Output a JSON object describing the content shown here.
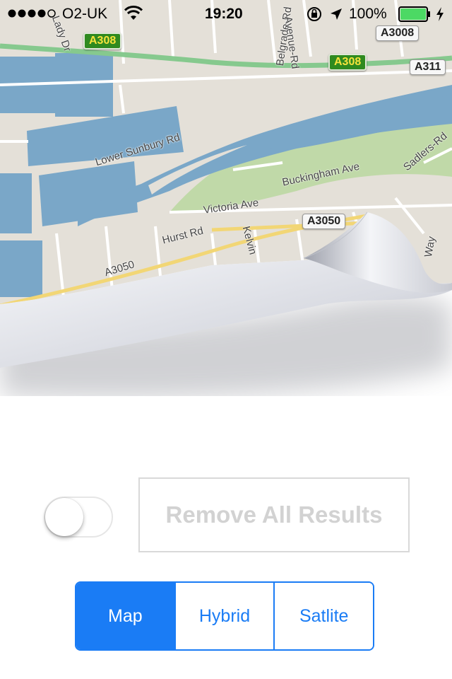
{
  "status_bar": {
    "carrier": "O2-UK",
    "time": "19:20",
    "battery": "100%"
  },
  "map": {
    "road_labels": {
      "lower_sunbury": "Lower Sunbury Rd",
      "buckingham": "Buckingham Ave",
      "victoria": "Victoria Ave",
      "hurst": "Hurst Rd",
      "a3050": "A3050",
      "belgrade": "Belgrade-Rd",
      "avenue": "Avenue-Rd",
      "sadlers": "Sadlers-Rd",
      "kelvin": "Kelvin",
      "way": "Way",
      "lady": "Lady Dr"
    },
    "shields": {
      "a308_left": "A308",
      "a308_right": "A308",
      "a3008": "A3008",
      "a311": "A311",
      "a3050": "A3050"
    }
  },
  "controls": {
    "toggle_on": false,
    "remove_all_label": "Remove All Results",
    "segments": [
      "Map",
      "Hybrid",
      "Satlite"
    ],
    "selected_segment": "Map"
  }
}
